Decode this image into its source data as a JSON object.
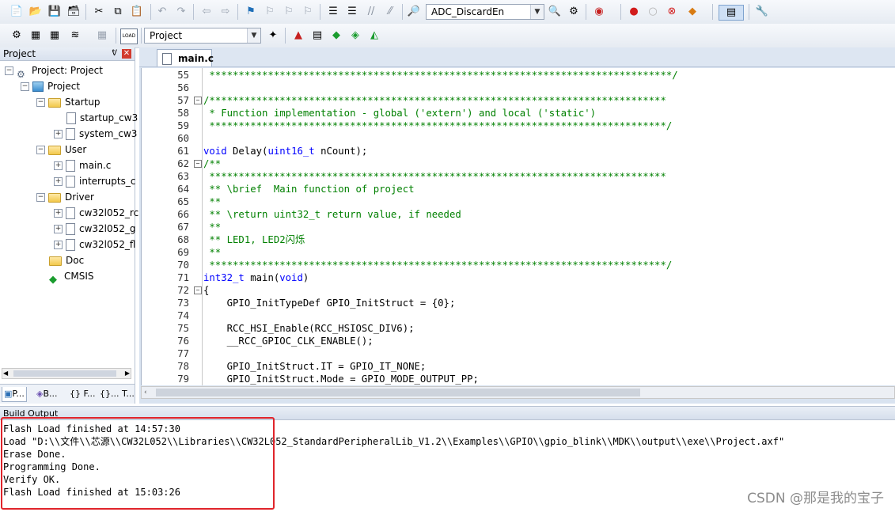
{
  "toolbar1": {
    "target_combo": "ADC_DiscardEn",
    "icons": [
      "new-file-icon",
      "open-folder-icon",
      "save-icon",
      "save-all-icon",
      "cut-icon",
      "copy-icon",
      "paste-icon",
      "undo-icon",
      "redo-icon",
      "nav-back-icon",
      "nav-forward-icon",
      "bookmark-icon",
      "prev-bookmark-icon",
      "next-bookmark-icon",
      "clear-bookmarks-icon",
      "indent-icon",
      "unindent-icon",
      "comment-icon",
      "uncomment-icon",
      "find-in-files-icon",
      "find-icon",
      "debug-icon",
      "breakpoint-icon",
      "disable-breakpoint-icon",
      "kill-breakpoints-icon",
      "tools-icon",
      "window-layout-icon",
      "settings-wrench-icon"
    ]
  },
  "toolbar2": {
    "target_select": "Project",
    "load_label": "LOAD"
  },
  "project_panel": {
    "title": "Project",
    "tree": [
      {
        "label": "Project: Project",
        "level": 0,
        "kind": "root"
      },
      {
        "label": "Project",
        "level": 1,
        "kind": "target"
      },
      {
        "label": "Startup",
        "level": 2,
        "kind": "folder"
      },
      {
        "label": "startup_cw3",
        "level": 3,
        "kind": "file"
      },
      {
        "label": "system_cw3",
        "level": 3,
        "kind": "file"
      },
      {
        "label": "User",
        "level": 2,
        "kind": "folder"
      },
      {
        "label": "main.c",
        "level": 3,
        "kind": "file"
      },
      {
        "label": "interrupts_c",
        "level": 3,
        "kind": "file"
      },
      {
        "label": "Driver",
        "level": 2,
        "kind": "folder"
      },
      {
        "label": "cw32l052_rc",
        "level": 3,
        "kind": "file"
      },
      {
        "label": "cw32l052_g",
        "level": 3,
        "kind": "file"
      },
      {
        "label": "cw32l052_fl",
        "level": 3,
        "kind": "file"
      },
      {
        "label": "Doc",
        "level": 2,
        "kind": "folder"
      },
      {
        "label": "CMSIS",
        "level": 2,
        "kind": "cmsis"
      }
    ],
    "tabs": [
      "P...",
      "B...",
      "{} F...",
      "{}... T..."
    ]
  },
  "editor": {
    "tab": "main.c",
    "lines": [
      {
        "n": "55",
        "text": " *******************************************************************************/"
      },
      {
        "n": "56",
        "text": ""
      },
      {
        "n": "57",
        "text": "/******************************************************************************",
        "fold": true
      },
      {
        "n": "58",
        "text": " * Function implementation - global ('extern') and local ('static')"
      },
      {
        "n": "59",
        "text": " ******************************************************************************/"
      },
      {
        "n": "60",
        "text": ""
      },
      {
        "n": "61",
        "text": "void Delay(uint16_t nCount);"
      },
      {
        "n": "62",
        "text": "/**",
        "fold": true
      },
      {
        "n": "63",
        "text": " ******************************************************************************"
      },
      {
        "n": "64",
        "text": " ** \\brief  Main function of project"
      },
      {
        "n": "65",
        "text": " **"
      },
      {
        "n": "66",
        "text": " ** \\return uint32_t return value, if needed"
      },
      {
        "n": "67",
        "text": " **"
      },
      {
        "n": "68",
        "text": " ** LED1, LED2闪烁"
      },
      {
        "n": "69",
        "text": " **"
      },
      {
        "n": "70",
        "text": " ******************************************************************************/"
      },
      {
        "n": "71",
        "text": "int32_t main(void)"
      },
      {
        "n": "72",
        "text": "{",
        "fold": true
      },
      {
        "n": "73",
        "text": "    GPIO_InitTypeDef GPIO_InitStruct = {0};"
      },
      {
        "n": "74",
        "text": ""
      },
      {
        "n": "75",
        "text": "    RCC_HSI_Enable(RCC_HSIOSC_DIV6);"
      },
      {
        "n": "76",
        "text": "    __RCC_GPIOC_CLK_ENABLE();"
      },
      {
        "n": "77",
        "text": ""
      },
      {
        "n": "78",
        "text": "    GPIO_InitStruct.IT = GPIO_IT_NONE;"
      },
      {
        "n": "79",
        "text": "    GPIO_InitStruct.Mode = GPIO_MODE_OUTPUT_PP;"
      }
    ]
  },
  "build_output": {
    "title": "Build Output",
    "lines": [
      "Flash Load finished at 14:57:30",
      "Load \"D:\\\\文件\\\\芯源\\\\CW32L052\\\\Libraries\\\\CW32L052_StandardPeripheralLib_V1.2\\\\Examples\\\\GPIO\\\\gpio_blink\\\\MDK\\\\output\\\\exe\\\\Project.axf\"",
      "Erase Done.",
      "Programming Done.",
      "Verify OK.",
      "Flash Load finished at 15:03:26"
    ]
  },
  "watermark": "CSDN @那是我的宝子",
  "colors": {
    "comment": "#008000",
    "keyword": "#0000ff",
    "highlight_box": "#e0242b"
  }
}
